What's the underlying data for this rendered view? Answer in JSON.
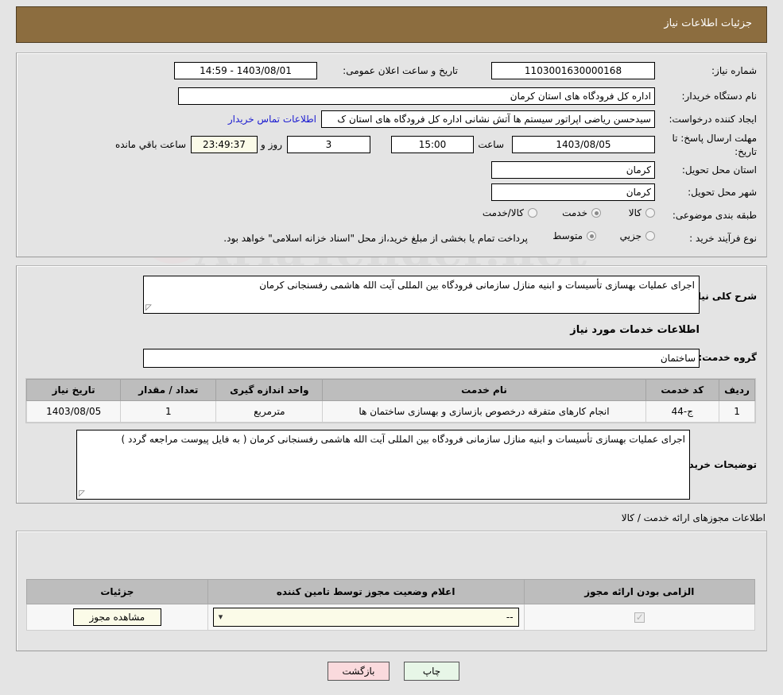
{
  "header": {
    "title": "جزئیات اطلاعات نیاز"
  },
  "watermark": {
    "text": "AriaTender.net"
  },
  "need_info": {
    "need_number_label": "شماره نیاز:",
    "need_number_value": "1103001630000168",
    "announce_datetime_label": "تاریخ و ساعت اعلان عمومی:",
    "announce_datetime_value": "1403/08/01 - 14:59",
    "buyer_org_label": "نام دستگاه خریدار:",
    "buyer_org_value": "اداره کل فرودگاه های استان کرمان",
    "requester_label": "ایجاد کننده درخواست:",
    "requester_value": "سیدحسن ریاضی اپراتور سیستم ها آتش نشانی اداره کل فرودگاه های استان ک",
    "buyer_contact_link": "اطلاعات تماس خریدار",
    "deadline_label": "مهلت ارسال پاسخ: تا تاریخ:",
    "deadline_date": "1403/08/05",
    "deadline_hour_label": "ساعت",
    "deadline_hour": "15:00",
    "remaining_days": "3",
    "remaining_days_label": "روز و",
    "remaining_time": "23:49:37",
    "remaining_time_label": "ساعت باقي مانده",
    "province_label": "استان محل تحویل:",
    "province_value": "کرمان",
    "city_label": "شهر محل تحویل:",
    "city_value": "کرمان",
    "category_label": "طبقه بندی موضوعی:",
    "category_options": [
      {
        "label": "کالا",
        "selected": false
      },
      {
        "label": "خدمت",
        "selected": true
      },
      {
        "label": "کالا/خدمت",
        "selected": false
      }
    ],
    "process_type_label": "نوع فرآیند خرید :",
    "process_options": [
      {
        "label": "جزیي",
        "selected": false
      },
      {
        "label": "متوسط",
        "selected": true
      }
    ],
    "payment_note": "پرداخت تمام یا بخشی از مبلغ خرید،از محل \"اسناد خزانه اسلامی\" خواهد بود."
  },
  "need_details": {
    "summary_label": "شرح کلی نیاز:",
    "summary_value": "اجرای عملیات بهسازی تأسیسات و ابنیه منازل سازمانی فرودگاه بین المللی آیت الله هاشمی رفسنجانی کرمان",
    "services_heading": "اطلاعات خدمات مورد نیاز",
    "service_group_label": "گروه خدمت:",
    "service_group_value": "ساختمان",
    "table": {
      "columns": [
        "ردیف",
        "کد خدمت",
        "نام خدمت",
        "واحد اندازه گیری",
        "تعداد / مقدار",
        "تاریخ نیاز"
      ],
      "rows": [
        [
          "1",
          "ج-44",
          "انجام کارهای متفرقه درخصوص بازسازی و بهسازی ساختمان ها",
          "مترمربع",
          "1",
          "1403/08/05"
        ]
      ]
    },
    "buyer_notes_label": "توضیحات خریدار:",
    "buyer_notes_value": "اجرای عملیات بهسازی تأسیسات و ابنیه منازل سازمانی فرودگاه بین المللی آیت الله هاشمی رفسنجانی کرمان ( به فایل پیوست مراجعه گردد )"
  },
  "permits": {
    "section_title": "اطلاعات مجوزهای ارائه خدمت / کالا",
    "columns": [
      "الزامی بودن ارائه مجوز",
      "اعلام وضعیت مجوز توسط تامین کننده",
      "جزئیات"
    ],
    "rows": [
      {
        "required_checked": true,
        "status_value": "--",
        "details_button": "مشاهده مجوز"
      }
    ]
  },
  "footer": {
    "print_label": "چاپ",
    "back_label": "بازگشت"
  },
  "colors": {
    "header_bar": "#8c6d3f",
    "page_bg": "#e4e4e4",
    "link": "#1a1ad0",
    "table_header": "#bdbdbd",
    "print_btn": "#e7f6e7",
    "back_btn": "#fadadd",
    "field_cream": "#fbfbe8"
  }
}
